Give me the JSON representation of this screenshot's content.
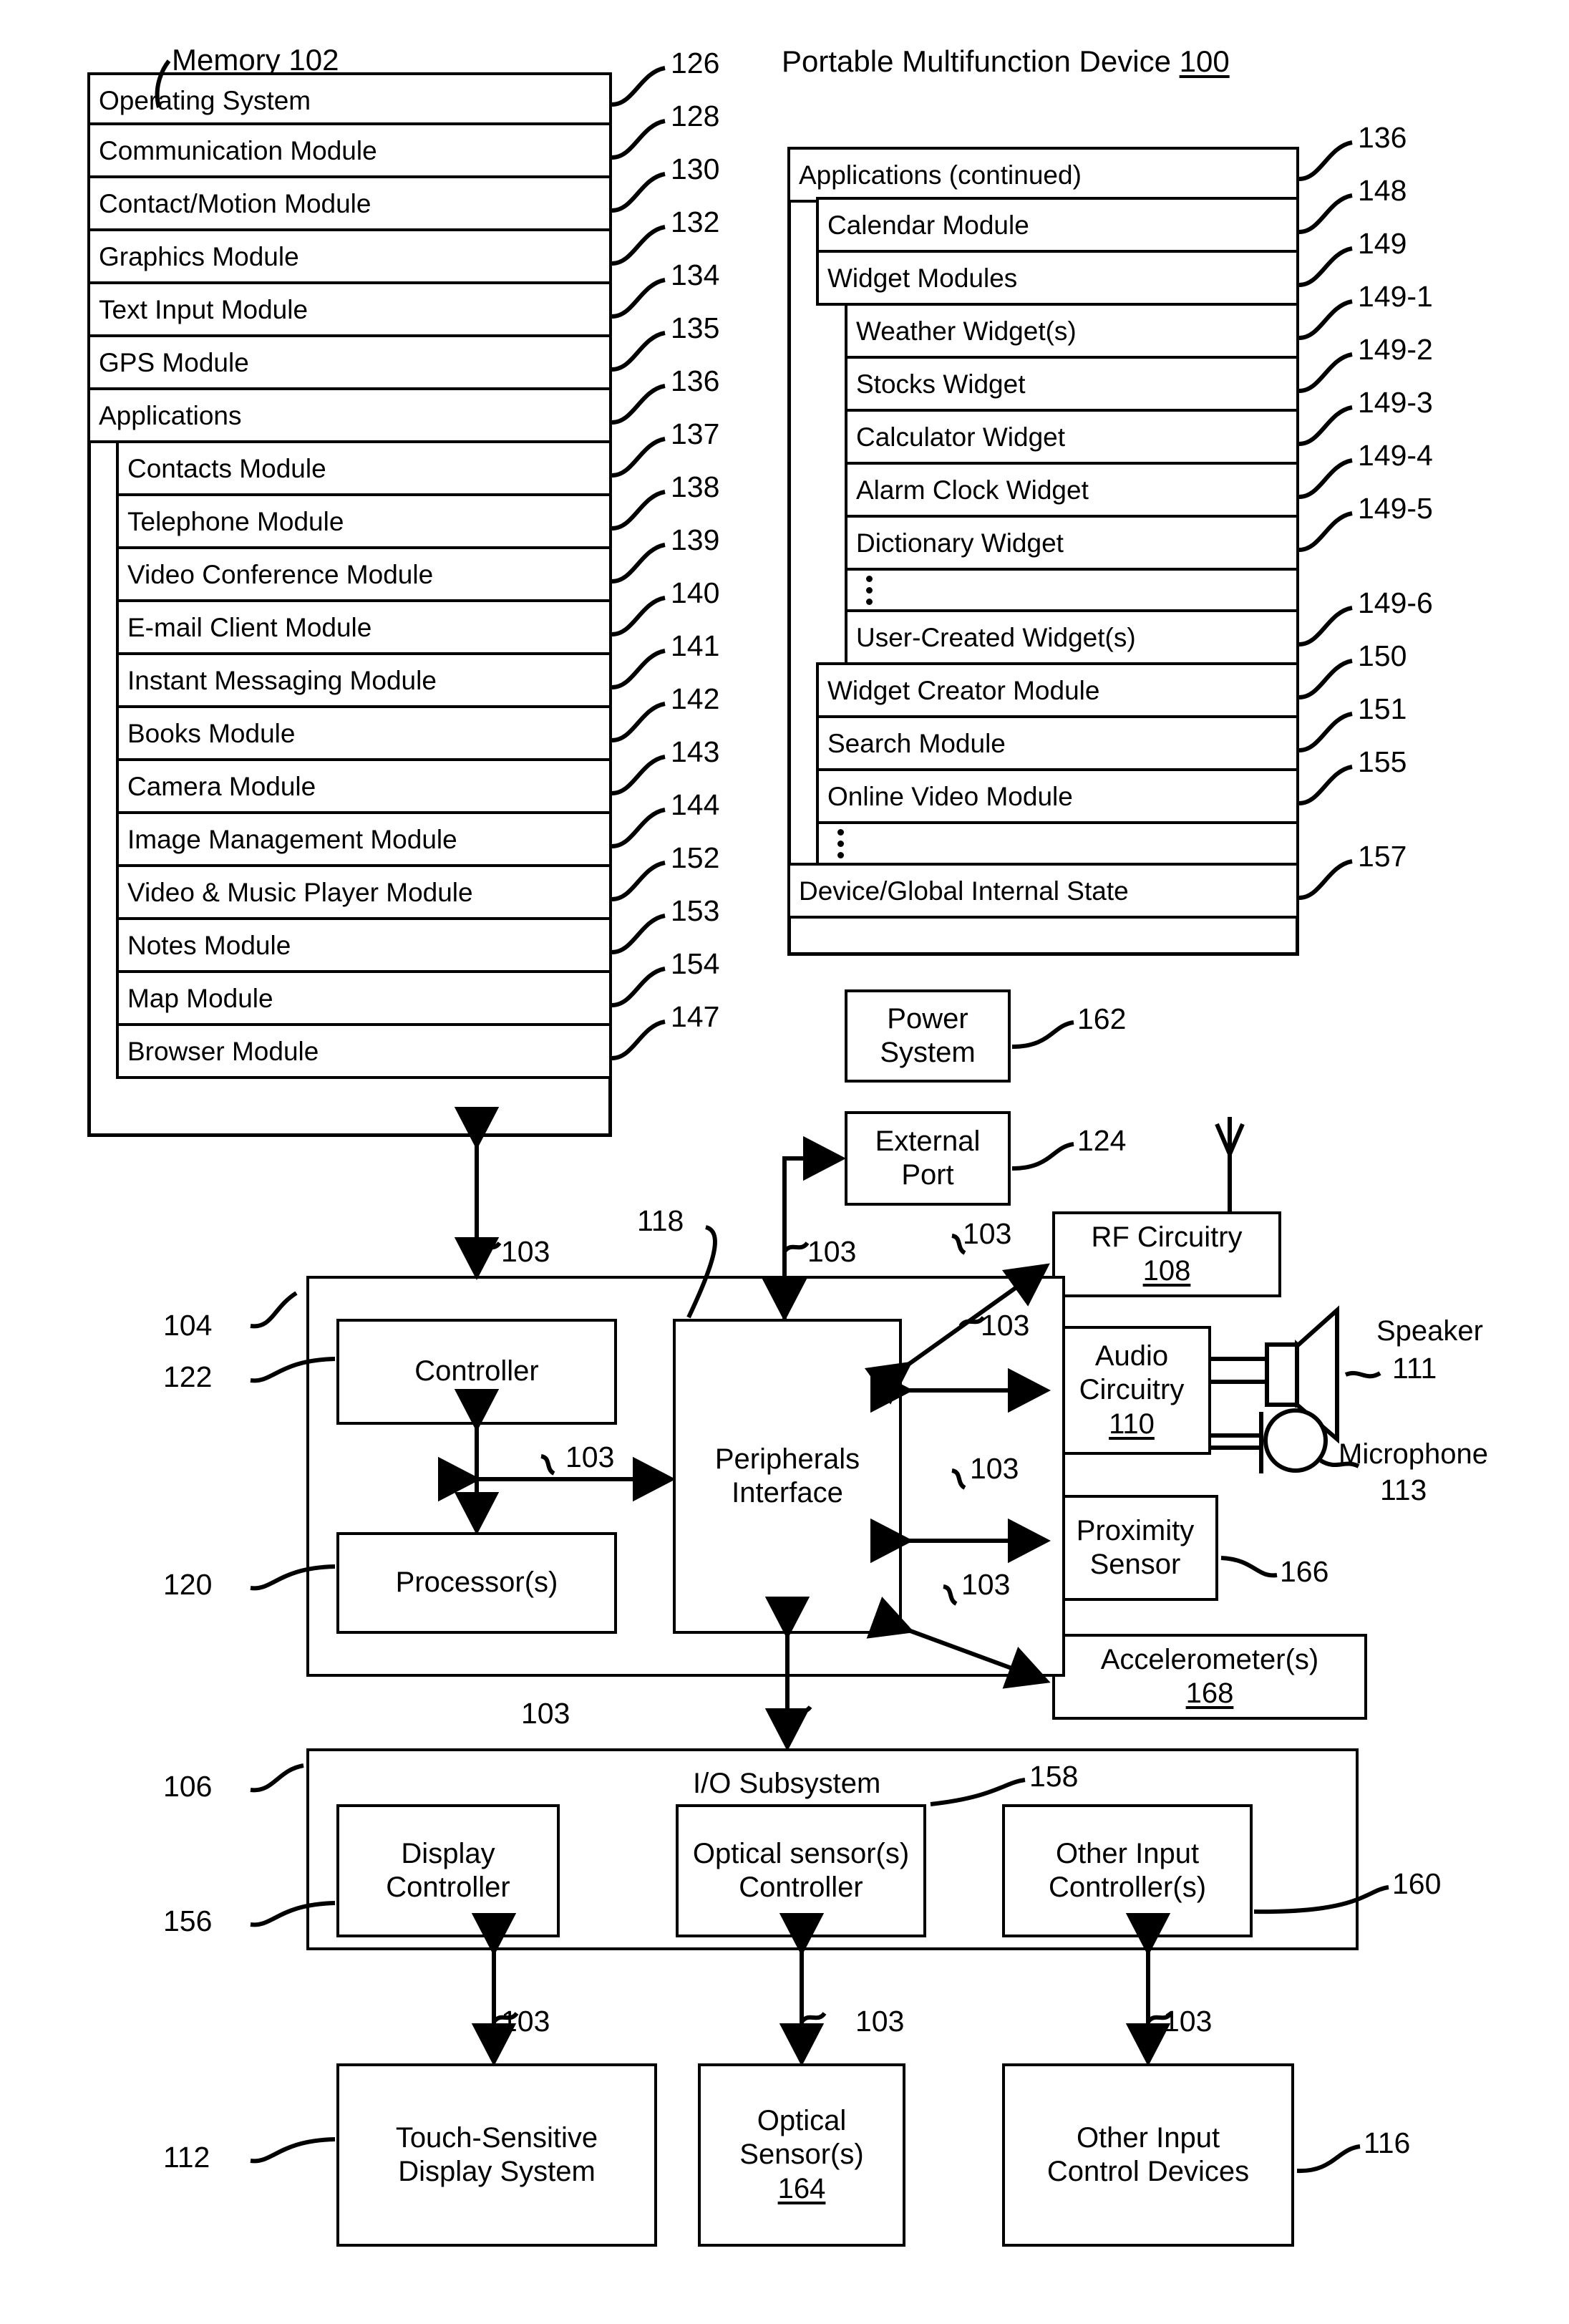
{
  "figure": {
    "memory_title": "Memory",
    "memory_ref": "102",
    "device_title": "Portable Multifunction Device",
    "device_ref": "100"
  },
  "memory_left": {
    "items": [
      {
        "label": "Operating System",
        "ref": "126",
        "level": 0
      },
      {
        "label": "Communication Module",
        "ref": "128",
        "level": 0
      },
      {
        "label": "Contact/Motion Module",
        "ref": "130",
        "level": 0
      },
      {
        "label": "Graphics Module",
        "ref": "132",
        "level": 0
      },
      {
        "label": "Text Input Module",
        "ref": "134",
        "level": 0
      },
      {
        "label": "GPS Module",
        "ref": "135",
        "level": 0
      },
      {
        "label": "Applications",
        "ref": "136",
        "level": 0
      },
      {
        "label": "Contacts Module",
        "ref": "137",
        "level": 1
      },
      {
        "label": "Telephone Module",
        "ref": "138",
        "level": 1
      },
      {
        "label": "Video Conference Module",
        "ref": "139",
        "level": 1
      },
      {
        "label": "E-mail Client Module",
        "ref": "140",
        "level": 1
      },
      {
        "label": "Instant Messaging Module",
        "ref": "141",
        "level": 1
      },
      {
        "label": "Books Module",
        "ref": "142",
        "level": 1
      },
      {
        "label": "Camera Module",
        "ref": "143",
        "level": 1
      },
      {
        "label": "Image Management Module",
        "ref": "144",
        "level": 1
      },
      {
        "label": "Video & Music Player Module",
        "ref": "152",
        "level": 1
      },
      {
        "label": "Notes Module",
        "ref": "153",
        "level": 1
      },
      {
        "label": "Map Module",
        "ref": "154",
        "level": 1
      },
      {
        "label": "Browser Module",
        "ref": "147",
        "level": 1
      }
    ]
  },
  "memory_right": {
    "items": [
      {
        "label": "Applications (continued)",
        "ref": "136",
        "level": 0
      },
      {
        "label": "Calendar Module",
        "ref": "148",
        "level": 1
      },
      {
        "label": "Widget Modules",
        "ref": "149",
        "level": 1
      },
      {
        "label": "Weather Widget(s)",
        "ref": "149-1",
        "level": 2
      },
      {
        "label": "Stocks Widget",
        "ref": "149-2",
        "level": 2
      },
      {
        "label": "Calculator Widget",
        "ref": "149-3",
        "level": 2
      },
      {
        "label": "Alarm Clock Widget",
        "ref": "149-4",
        "level": 2
      },
      {
        "label": "Dictionary Widget",
        "ref": "149-5",
        "level": 2
      },
      {
        "label": "",
        "ref": "",
        "level": 2,
        "ellipsis": true
      },
      {
        "label": "User-Created Widget(s)",
        "ref": "149-6",
        "level": 2
      },
      {
        "label": "Widget Creator Module",
        "ref": "150",
        "level": 1
      },
      {
        "label": "Search Module",
        "ref": "151",
        "level": 1
      },
      {
        "label": "Online Video Module",
        "ref": "155",
        "level": 1
      },
      {
        "label": "",
        "ref": "",
        "level": 1,
        "ellipsis": true
      },
      {
        "label": "Device/Global Internal State",
        "ref": "157",
        "level": 0
      }
    ]
  },
  "blocks": {
    "power_system": {
      "line1": "Power",
      "line2": "System",
      "ref": "162"
    },
    "external_port": {
      "line1": "External",
      "line2": "Port",
      "ref": "124"
    },
    "rf_circuitry": {
      "line1": "RF Circuitry",
      "ref_inline": "108"
    },
    "audio_circuitry": {
      "line1": "Audio",
      "line2": "Circuitry",
      "ref_inline": "110"
    },
    "speaker": {
      "label": "Speaker",
      "ref": "111"
    },
    "microphone": {
      "label": "Microphone",
      "ref": "113"
    },
    "proximity_sensor": {
      "line1": "Proximity",
      "line2": "Sensor",
      "ref": "166"
    },
    "accelerometer": {
      "line1": "Accelerometer(s)",
      "ref_inline": "168"
    },
    "controller": {
      "label": "Controller",
      "ref": "122"
    },
    "processor": {
      "label": "Processor(s)",
      "ref": "120"
    },
    "peripherals_interface": {
      "line1": "Peripherals",
      "line2": "Interface",
      "ref": "118"
    },
    "cpu_group_ref": "104",
    "io_subsystem": {
      "label": "I/O Subsystem",
      "ref": "106"
    },
    "display_controller": {
      "line1": "Display",
      "line2": "Controller",
      "ref": "156"
    },
    "optical_sensor_controller": {
      "line1": "Optical sensor(s)",
      "line2": "Controller",
      "ref": "158"
    },
    "other_input_controller": {
      "line1": "Other Input",
      "line2": "Controller(s)",
      "ref": "160"
    },
    "touch_display": {
      "line1": "Touch-Sensitive",
      "line2": "Display System",
      "ref": "112"
    },
    "optical_sensors": {
      "line1": "Optical",
      "line2": "Sensor(s)",
      "ref_inline": "164"
    },
    "other_input_devices": {
      "line1": "Other Input",
      "line2": "Control Devices",
      "ref": "116"
    }
  },
  "bus_label": "103",
  "bus_labels": {
    "memory_to_controller": "103",
    "external_port_bus": "103",
    "rf_bus": "103",
    "audio_bus": "103",
    "controller_processor_bus": "103",
    "proximity_bus": "103",
    "accelerometer_bus": "103",
    "io_bus": "103",
    "display_bus": "103",
    "optical_bus": "103",
    "other_input_bus": "103"
  }
}
